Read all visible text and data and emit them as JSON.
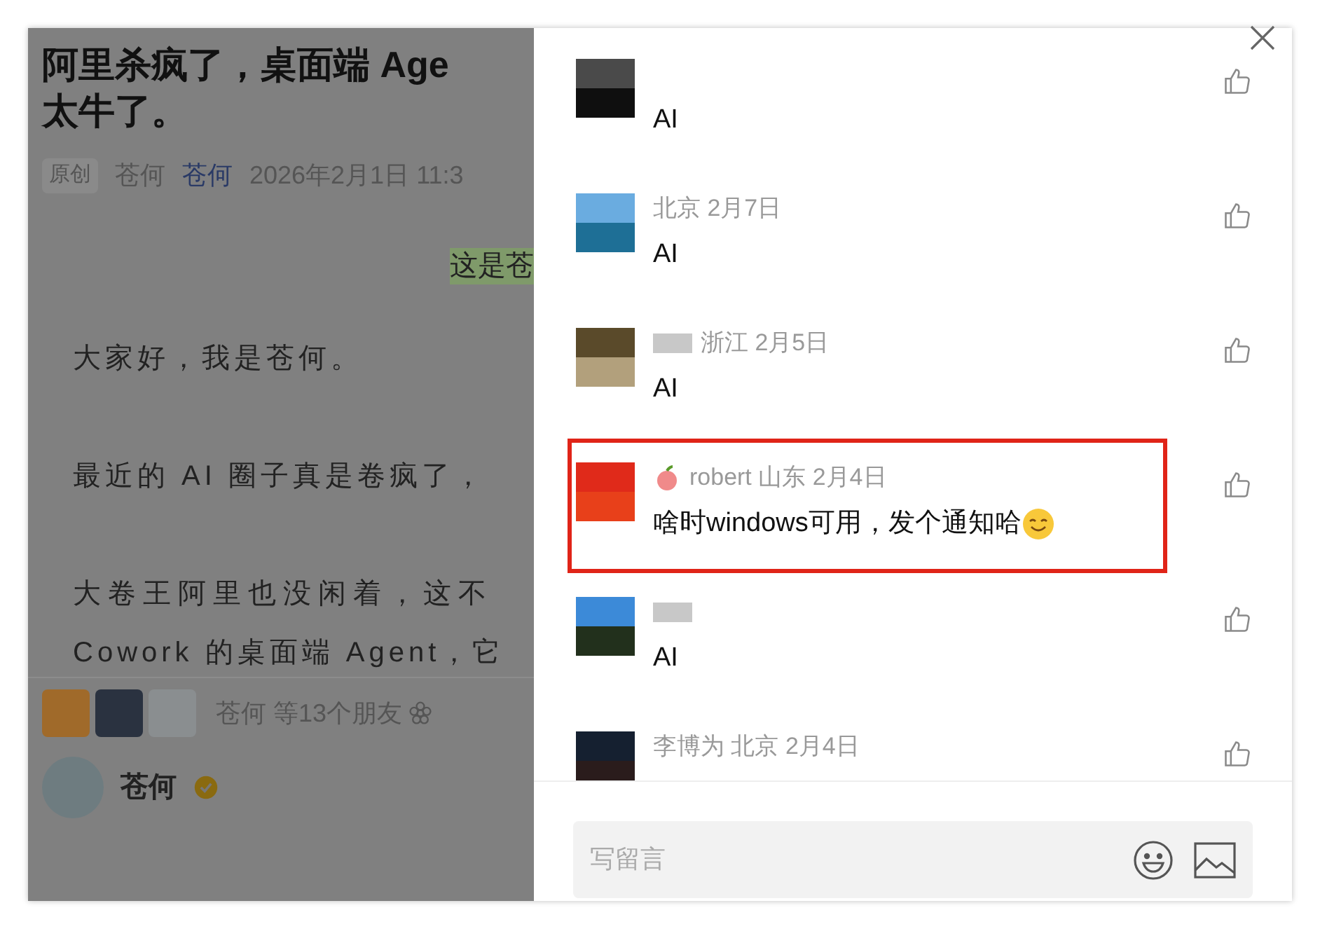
{
  "article": {
    "title_lines": [
      "阿里杀疯了，桌面端 Age",
      "太牛了。"
    ],
    "tag": "原创",
    "author": "苍何",
    "account": "苍何",
    "date": "2026年2月1日 11:3",
    "highlight": "这是苍",
    "paragraphs": [
      "大家好，我是苍何。",
      "最近的 AI 圈子真是卷疯了，",
      "大卷王阿里也没闲着，这不",
      "Cowork 的桌面端 Agent，它"
    ],
    "friends_text": "苍何 等13个朋友",
    "author_name": "苍何",
    "verified": true
  },
  "comments": [
    {
      "content": "AI",
      "name_redacted": false,
      "fruit_icon": false,
      "smile_emoji": false,
      "highlighted": false
    },
    {
      "meta": "北京 2月7日",
      "content": "AI",
      "name_redacted": false,
      "fruit_icon": false,
      "smile_emoji": false,
      "highlighted": false
    },
    {
      "meta": "浙江 2月5日",
      "content": "AI",
      "name_redacted": true,
      "fruit_icon": false,
      "smile_emoji": false,
      "highlighted": false
    },
    {
      "meta": "robert 山东 2月4日",
      "content": "啥时windows可用，发个通知哈",
      "name_redacted": false,
      "fruit_icon": true,
      "smile_emoji": true,
      "highlighted": true
    },
    {
      "content": "AI",
      "name_redacted": true,
      "fruit_icon": false,
      "smile_emoji": false,
      "highlighted": false
    },
    {
      "meta": "李博为 北京 2月4日",
      "name_redacted": false,
      "fruit_icon": false,
      "smile_emoji": false,
      "highlighted": false
    }
  ],
  "comment_box": {
    "placeholder": "写留言"
  }
}
